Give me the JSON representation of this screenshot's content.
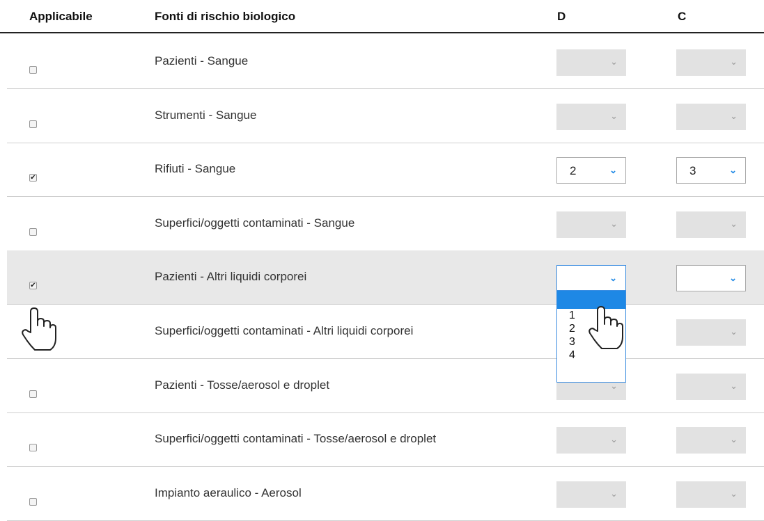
{
  "header": {
    "applicable": "Applicabile",
    "source": "Fonti di rischio biologico",
    "d": "D",
    "c": "C"
  },
  "rows": [
    {
      "label": "Pazienti - Sangue",
      "checked": false,
      "d": "",
      "c": ""
    },
    {
      "label": "Strumenti - Sangue",
      "checked": false,
      "d": "",
      "c": ""
    },
    {
      "label": "Rifiuti - Sangue",
      "checked": true,
      "d": "2",
      "c": "3"
    },
    {
      "label": "Superfici/oggetti contaminati - Sangue",
      "checked": false,
      "d": "",
      "c": ""
    },
    {
      "label": "Pazienti - Altri liquidi corporei",
      "checked": true,
      "d": "",
      "c": ""
    },
    {
      "label": "Superfici/oggetti contaminati - Altri liquidi corporei",
      "checked": false,
      "d": "",
      "c": ""
    },
    {
      "label": "Pazienti - Tosse/aerosol e droplet",
      "checked": false,
      "d": "",
      "c": ""
    },
    {
      "label": "Superfici/oggetti contaminati - Tosse/aerosol e droplet",
      "checked": false,
      "d": "",
      "c": ""
    },
    {
      "label": "Impianto aeraulico - Aerosol",
      "checked": false,
      "d": "",
      "c": ""
    }
  ],
  "dropdown": {
    "options": [
      "1",
      "2",
      "3",
      "4"
    ]
  },
  "icons": {
    "check": "✔",
    "chevron": "⌄",
    "cursor": "hand-pointer-icon"
  },
  "colors": {
    "accent": "#1e88e5",
    "disabled_select": "#e2e2e2",
    "highlight_row": "#e8e8e8"
  }
}
